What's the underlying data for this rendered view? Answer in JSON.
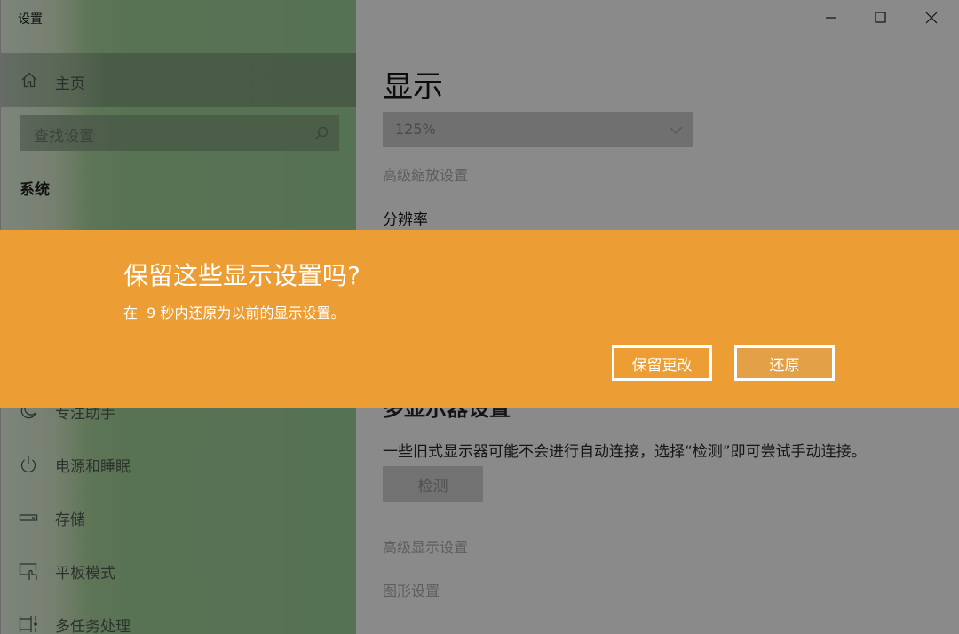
{
  "window": {
    "title": "设置",
    "controls": {
      "minimize": "minimize-icon",
      "maximize": "maximize-icon",
      "close": "close-icon"
    }
  },
  "sidebar": {
    "home": {
      "label": "主页",
      "icon": "home-icon"
    },
    "search": {
      "placeholder": "查找设置",
      "icon": "search-icon"
    },
    "section": "系统",
    "items": [
      {
        "label": "专注助手",
        "icon": "moon-icon"
      },
      {
        "label": "电源和睡眠",
        "icon": "power-icon"
      },
      {
        "label": "存储",
        "icon": "storage-icon"
      },
      {
        "label": "平板模式",
        "icon": "tablet-mode-icon"
      },
      {
        "label": "多任务处理",
        "icon": "multitasking-icon"
      }
    ]
  },
  "main": {
    "title": "显示",
    "scale_dropdown": {
      "value": "125%",
      "icon": "chevron-down-icon"
    },
    "advanced_scaling_link": "高级缩放设置",
    "resolution_label": "分辨率",
    "multi_display_heading": "多显示器设置",
    "multi_display_desc": "一些旧式显示器可能不会进行自动连接，选择“检测”即可尝试手动连接。",
    "detect_button": "检测",
    "advanced_display_link": "高级显示设置",
    "graphics_link": "图形设置"
  },
  "banner": {
    "title": "保留这些显示设置吗?",
    "message": "在  9 秒内还原为以前的显示设置。",
    "countdown_seconds": 9,
    "keep_button": "保留更改",
    "revert_button": "还原",
    "color": "#ec9d33"
  }
}
